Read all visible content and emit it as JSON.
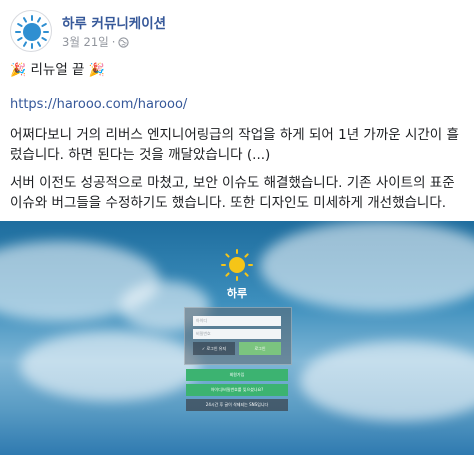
{
  "post": {
    "page_name": "하루 커뮤니케이션",
    "date": "3월 21일",
    "separator": "·",
    "title_emoji": "🎉",
    "title": "리뉴얼 끝",
    "link": "https://harooo.com/harooo/",
    "paragraph1": "어쩌다보니 거의 리버스 엔지니어링급의 작업을 하게 되어 1년 가까운 시간이 흘렀습니다. 하면 된다는 것을 깨달았습니다 (...)",
    "paragraph2": "서버 이전도 성공적으로 마쳤고, 보안 이슈도 해결했습니다. 기존 사이트의 표준 이슈와 버그들을 수정하기도 했습니다. 또한 디자인도 미세하게 개선했습니다."
  },
  "preview": {
    "logo_text": "하루",
    "username_placeholder": "아이디",
    "password_placeholder": "비밀번호",
    "keep_login_label": "✓ 로그인 유지",
    "login_button": "로그인",
    "signup_label": "회원가입",
    "find_account_label": "아이디/비밀번호를 잊으셨나요?",
    "notice_label": "24시간 후 글이 삭제되는 SNS입니다",
    "colors": {
      "sky": "#3d8fbd",
      "green": "#3cb371",
      "sun": "#f5c518"
    }
  },
  "icons": {
    "avatar": "sun-logo-icon",
    "privacy": "globe-icon"
  }
}
